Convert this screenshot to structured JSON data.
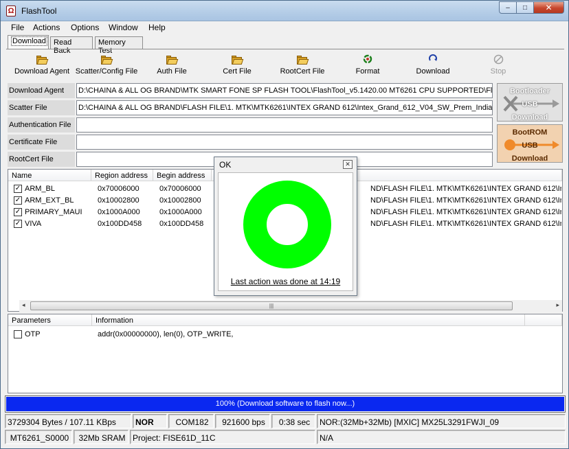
{
  "window": {
    "title": "FlashTool",
    "app_icon": "flashtool-logo-icon",
    "min": "–",
    "max": "□",
    "close": "✕"
  },
  "menu": [
    "File",
    "Actions",
    "Options",
    "Window",
    "Help"
  ],
  "tabs": [
    {
      "label": "Download",
      "active": true
    },
    {
      "label": "Read Back",
      "active": false
    },
    {
      "label": "Memory Test",
      "active": false
    }
  ],
  "toolbar": [
    {
      "label": "Download Agent",
      "icon": "folder-open-icon"
    },
    {
      "label": "Scatter/Config File",
      "icon": "folder-open-icon"
    },
    {
      "label": "Auth File",
      "icon": "folder-open-icon"
    },
    {
      "label": "Cert File",
      "icon": "folder-open-icon"
    },
    {
      "label": "RootCert File",
      "icon": "folder-open-icon"
    },
    {
      "label": "Format",
      "icon": "format-icon"
    },
    {
      "label": "Download",
      "icon": "download-arrow-icon"
    },
    {
      "label": "Stop",
      "icon": "stop-icon"
    }
  ],
  "fields": [
    {
      "label": "Download Agent",
      "value": "D:\\CHAINA & ALL OG BRAND\\MTK SMART FONE SP FLASH TOOL\\FlashTool_v5.1420.00 MT6261 CPU SUPPORTED\\Fla"
    },
    {
      "label": "Scatter File",
      "value": "D:\\CHAINA & ALL OG BRAND\\FLASH FILE\\1. MTK\\MTK6261\\INTEX GRAND 612\\Intex_Grand_612_V04_SW_Prem_India\\"
    },
    {
      "label": "Authentication File",
      "value": ""
    },
    {
      "label": "Certificate File",
      "value": ""
    },
    {
      "label": "RootCert File",
      "value": ""
    }
  ],
  "side_buttons": {
    "bootloader": "Bootloader\nUSB\nDownload",
    "bootrom": "BootROM\nUSB\nDownload"
  },
  "rom_table": {
    "headers": [
      "Name",
      "Region address",
      "Begin address"
    ],
    "rows": [
      {
        "name": "ARM_BL",
        "region": "0x70006000",
        "begin": "0x70006000",
        "path": "ND\\FLASH FILE\\1. MTK\\MTK6261\\INTEX GRAND 612\\Inte",
        "checked": true
      },
      {
        "name": "ARM_EXT_BL",
        "region": "0x10002800",
        "begin": "0x10002800",
        "path": "ND\\FLASH FILE\\1. MTK\\MTK6261\\INTEX GRAND 612\\Inte",
        "checked": true
      },
      {
        "name": "PRIMARY_MAUI",
        "region": "0x1000A000",
        "begin": "0x1000A000",
        "path": "ND\\FLASH FILE\\1. MTK\\MTK6261\\INTEX GRAND 612\\Inte",
        "checked": true
      },
      {
        "name": "VIVA",
        "region": "0x100DD458",
        "begin": "0x100DD458",
        "path": "ND\\FLASH FILE\\1. MTK\\MTK6261\\INTEX GRAND 612\\Inte",
        "checked": true
      }
    ],
    "scroll_thumb": "|||"
  },
  "params_table": {
    "headers": [
      "Parameters",
      "Information"
    ],
    "rows": [
      {
        "name": "OTP",
        "info": "addr(0x00000000), len(0), OTP_WRITE,",
        "checked": false
      }
    ]
  },
  "progress": {
    "percent": 100,
    "text": "100% (Download software to flash now...)"
  },
  "status": {
    "row1": [
      "3729304 Bytes / 107.11 KBps",
      "NOR",
      "COM182",
      "921600 bps",
      "0:38 sec",
      "NOR:(32Mb+32Mb) [MXIC] MX25L3291FWJI_09"
    ],
    "row2": [
      "MT6261_S0000",
      "32Mb SRAM",
      "Project: FISE61D_11C",
      "N/A"
    ]
  },
  "dialog": {
    "title": "OK",
    "close": "✕",
    "message": "Last action was done at 14:19",
    "ring_color": "#00ff00"
  }
}
